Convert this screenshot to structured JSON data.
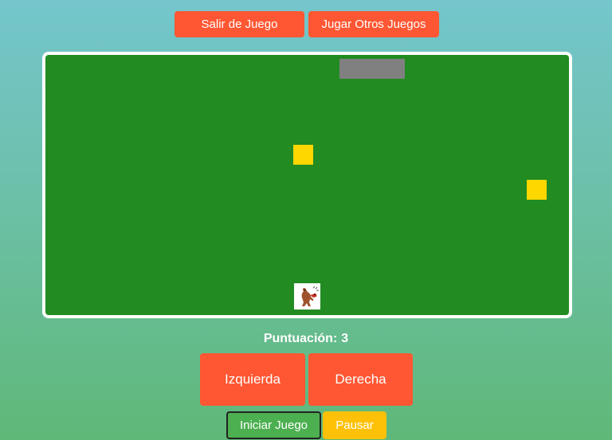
{
  "header": {
    "exit_label": "Salir de Juego",
    "other_games_label": "Jugar Otros Juegos"
  },
  "game": {
    "board_color": "#228b22",
    "obstacle_color": "#808080",
    "coin_color": "#ffd700",
    "player_icon": "dog-character-icon"
  },
  "score": {
    "label": "Puntuación:",
    "value": "3"
  },
  "controls": {
    "left_label": "Izquierda",
    "right_label": "Derecha",
    "start_label": "Iniciar Juego",
    "pause_label": "Pausar"
  },
  "colors": {
    "accent": "#ff5733",
    "start": "#4caf50",
    "pause": "#ffc107"
  }
}
